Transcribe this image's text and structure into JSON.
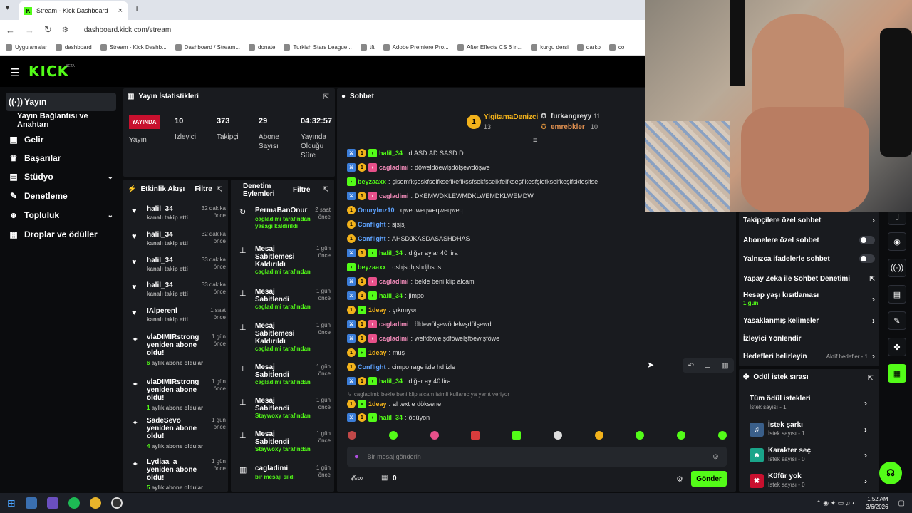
{
  "browser": {
    "tab_title": "Stream - Kick Dashboard",
    "url": "dashboard.kick.com/stream",
    "bookmarks": [
      "Uygulamalar",
      "dashboard",
      "Stream - Kick Dashb...",
      "Dashboard / Stream...",
      "donate",
      "Turkish Stars League...",
      "tft",
      "Adobe Premiere Pro...",
      "After Effects CS 6 in...",
      "kurgu dersi",
      "darko",
      "co"
    ]
  },
  "sidebar": {
    "items": [
      {
        "label": "Yayın",
        "icon": "broadcast-icon"
      },
      {
        "label": "Yayın Bağlantısı ve Anahtarı"
      },
      {
        "label": "Gelir",
        "icon": "money-icon"
      },
      {
        "label": "Başarılar",
        "icon": "trophy-icon"
      },
      {
        "label": "Stüdyo",
        "icon": "studio-icon"
      },
      {
        "label": "Denetleme",
        "icon": "wrench-icon"
      },
      {
        "label": "Topluluk",
        "icon": "community-icon"
      },
      {
        "label": "Droplar ve ödüller",
        "icon": "gift-icon"
      }
    ]
  },
  "stats": {
    "title": "Yayın İstatistikleri",
    "live_badge": "YAYINDA",
    "live_label": "Yayın",
    "viewers": "10",
    "viewers_label": "İzleyici",
    "followers": "373",
    "followers_label": "Takipçi",
    "subs": "29",
    "subs_label": "Abone Sayısı",
    "duration": "04:32:57",
    "duration_label": "Yayında Olduğu Süre"
  },
  "activity": {
    "title": "Etkinlik Akışı",
    "filter": "Filtre",
    "items": [
      {
        "name": "halil_34",
        "sub": "kanalı takip etti",
        "time": "32 dakika önce"
      },
      {
        "name": "halil_34",
        "sub": "kanalı takip etti",
        "time": "32 dakika önce"
      },
      {
        "name": "halil_34",
        "sub": "kanalı takip etti",
        "time": "33 dakika önce"
      },
      {
        "name": "halil_34",
        "sub": "kanalı takip etti",
        "time": "33 dakika önce"
      },
      {
        "name": "IAlperenl",
        "sub": "kanalı takip etti",
        "time": "1 saat önce"
      },
      {
        "name": "vlaDIMIRstrong yeniden abone oldu!",
        "sub_num": "6",
        "sub": "aylık abone oldular",
        "time": "1 gün önce"
      },
      {
        "name": "vlaDIMIRstrong yeniden abone oldu!",
        "sub_num": "1",
        "sub": "aylık abone oldular",
        "time": "1 gün önce"
      },
      {
        "name": "SadeSevo yeniden abone oldu!",
        "sub_num": "4",
        "sub": "aylık abone oldular",
        "time": "1 gün önce"
      },
      {
        "name": "Lydiaa_a yeniden abone oldu!",
        "sub_num": "5",
        "sub": "aylık abone oldular",
        "time": "1 gün önce"
      }
    ]
  },
  "moderation": {
    "title": "Denetim Eylemleri",
    "filter": "Filtre",
    "items": [
      {
        "name": "PermaBanOnur",
        "by": "cagladimi",
        "sub": "tarafından yasağı kaldırıldı",
        "time": "2 saat önce"
      },
      {
        "name": "Mesaj Sabitlemesi Kaldırıldı",
        "by": "cagladimi",
        "sub": "tarafından",
        "time": "1 gün önce"
      },
      {
        "name": "Mesaj Sabitlendi",
        "by": "cagladimi",
        "sub": "tarafından",
        "time": "1 gün önce"
      },
      {
        "name": "Mesaj Sabitlemesi Kaldırıldı",
        "by": "cagladimi",
        "sub": "tarafından",
        "time": "1 gün önce"
      },
      {
        "name": "Mesaj Sabitlendi",
        "by": "cagladimi",
        "sub": "tarafından",
        "time": "1 gün önce"
      },
      {
        "name": "Mesaj Sabitlendi",
        "by": "Staywoxy",
        "sub": "tarafından",
        "time": "1 gün önce"
      },
      {
        "name": "Mesaj Sabitlendi",
        "by": "Staywoxy",
        "sub": "tarafından",
        "time": "1 gün önce"
      },
      {
        "name": "cagladimi",
        "by": "",
        "sub": "bir mesajı sildi",
        "time": "1 gün önce"
      }
    ]
  },
  "chat": {
    "title": "Sohbet",
    "top_gifters": [
      {
        "name": "YigitamaDenizci",
        "count": "13"
      },
      {
        "name": "furkangreyy",
        "count": "11"
      },
      {
        "name": "emrebkler",
        "count": "10"
      }
    ],
    "messages": [
      {
        "user": "halil_34",
        "color": "green",
        "text": "d:ASD:AD:SASD:D:"
      },
      {
        "user": "cagladimi",
        "color": "pink",
        "text": "döweldöewlşdölşewdöşwe"
      },
      {
        "user": "beyzaaxx",
        "color": "green",
        "text": "şlsemfkşeskfselfkseflkeflkşsfsekfşselkfelfkseşflkesfşlefkselfkeşlfskfeşlfse"
      },
      {
        "user": "cagladimi",
        "color": "pink",
        "text": "DKEMWDKLEWMDKLWEMDKLWEMDW"
      },
      {
        "user": "Onurylmz10",
        "color": "blue",
        "text": "qweqweqweqweqweq"
      },
      {
        "user": "Conflight",
        "color": "blue",
        "text": "sjsjsj"
      },
      {
        "user": "Conflight",
        "color": "blue",
        "text": "AHSDJKASDASASHDHAS"
      },
      {
        "user": "halil_34",
        "color": "green",
        "text": "diğer aylar 40 lira"
      },
      {
        "user": "beyzaaxx",
        "color": "green",
        "text": "dshjsdhjshdjhsds"
      },
      {
        "user": "cagladimi",
        "color": "pink",
        "text": "bekle beni klip alcam"
      },
      {
        "user": "halil_34",
        "color": "green",
        "text": "jimpo"
      },
      {
        "user": "1deay",
        "color": "gold",
        "text": "çıkmıyor"
      },
      {
        "user": "cagladimi",
        "color": "pink",
        "text": "öldewölşewödelwşdölşewd"
      },
      {
        "user": "cagladimi",
        "color": "pink",
        "text": "welfdöwelşdföwelşföewlşföwe"
      },
      {
        "user": "1deay",
        "color": "gold",
        "text": "muş"
      },
      {
        "user": "Conflight",
        "color": "blue",
        "text": "cimpo rage izle hd izle"
      },
      {
        "user": "halil_34",
        "color": "green",
        "text": "diğer ay 40 lira"
      },
      {
        "user": "1deay",
        "color": "gold",
        "text": "al text e döksene",
        "reply": "cagladimi: bekle beni klip alcam isimli kullanıcıya yanıt veriyor"
      },
      {
        "user": "halil_34",
        "color": "green",
        "text": "ödüyon"
      }
    ],
    "placeholder": "Bir mesaj gönderin",
    "points": "0",
    "send": "Gönder"
  },
  "chat_settings": {
    "items": [
      {
        "label": "Takipçilere özel sohbet"
      },
      {
        "label": "Abonelere özel sohbet"
      },
      {
        "label": "Yalnızca ifadelerle sohbet"
      },
      {
        "label": "Yapay Zeka ile Sohbet Denetimi"
      },
      {
        "label": "Hesap yaşı kısıtlaması",
        "sub": "1 gün"
      },
      {
        "label": "Yasaklanmış kelimeler"
      },
      {
        "label": "İzleyici Yönlendir"
      },
      {
        "label": "Hedefleri belirleyin",
        "sub": "Aktif hedefler - 1"
      }
    ]
  },
  "rewards": {
    "title": "Ödül istek sırası",
    "items": [
      {
        "label": "Tüm ödül istekleri",
        "sub": "İstek sayısı - 1"
      },
      {
        "label": "İstek şarkı",
        "sub": "İstek sayısı - 1"
      },
      {
        "label": "Karakter seç",
        "sub": "İstek sayısı - 0"
      },
      {
        "label": "Küfür yok",
        "sub": "İstek sayısı - 0"
      }
    ]
  },
  "taskbar": {
    "time": "1:52 AM",
    "date": "3/6/2026"
  },
  "colors": {
    "accent": "#53fc18",
    "panel": "#191b1f",
    "live": "#c8102e"
  }
}
